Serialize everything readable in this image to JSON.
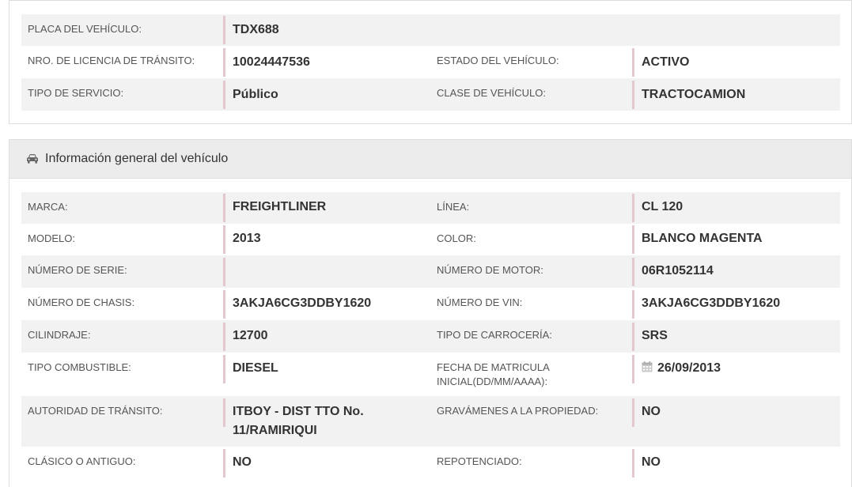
{
  "top_info": [
    {
      "left_label": "PLACA DEL VEHÍCULO:",
      "left_value": "TDX688",
      "right_label": "",
      "right_value": ""
    },
    {
      "left_label": "NRO. DE LICENCIA DE TRÁNSITO:",
      "left_value": "10024447536",
      "right_label": "ESTADO DEL VEHÍCULO:",
      "right_value": "ACTIVO"
    },
    {
      "left_label": "TIPO DE SERVICIO:",
      "left_value": "Público",
      "right_label": "CLASE DE VEHÍCULO:",
      "right_value": "TRACTOCAMION"
    }
  ],
  "general_section": {
    "icon": "car-icon",
    "title": "Información general del vehículo"
  },
  "general_info": [
    {
      "left_label": "MARCA:",
      "left_value": "FREIGHTLINER",
      "right_label": "LÍNEA:",
      "right_value": "CL 120"
    },
    {
      "left_label": "MODELO:",
      "left_value": "2013",
      "right_label": "COLOR:",
      "right_value": "BLANCO MAGENTA"
    },
    {
      "left_label": "NÚMERO DE SERIE:",
      "left_value": "",
      "right_label": "NÚMERO DE MOTOR:",
      "right_value": "06R1052114"
    },
    {
      "left_label": "NÚMERO DE CHASIS:",
      "left_value": "3AKJA6CG3DDBY1620",
      "right_label": "NÚMERO DE VIN:",
      "right_value": "3AKJA6CG3DDBY1620"
    },
    {
      "left_label": "CILINDRAJE:",
      "left_value": "12700",
      "right_label": "TIPO DE CARROCERÍA:",
      "right_value": "SRS"
    },
    {
      "left_label": "TIPO COMBUSTIBLE:",
      "left_value": "DIESEL",
      "right_label": "FECHA DE MATRICULA INICIAL(DD/MM/AAAA):",
      "right_value": "26/09/2013"
    },
    {
      "left_label": "AUTORIDAD DE TRÁNSITO:",
      "left_value": "ITBOY - DIST TTO No. 11/RAMIRIQUI",
      "right_label": "GRAVÁMENES A LA PROPIEDAD:",
      "right_value": "NO"
    },
    {
      "left_label": "CLÁSICO O ANTIGUO:",
      "left_value": "NO",
      "right_label": "REPOTENCIADO:",
      "right_value": "NO"
    }
  ]
}
